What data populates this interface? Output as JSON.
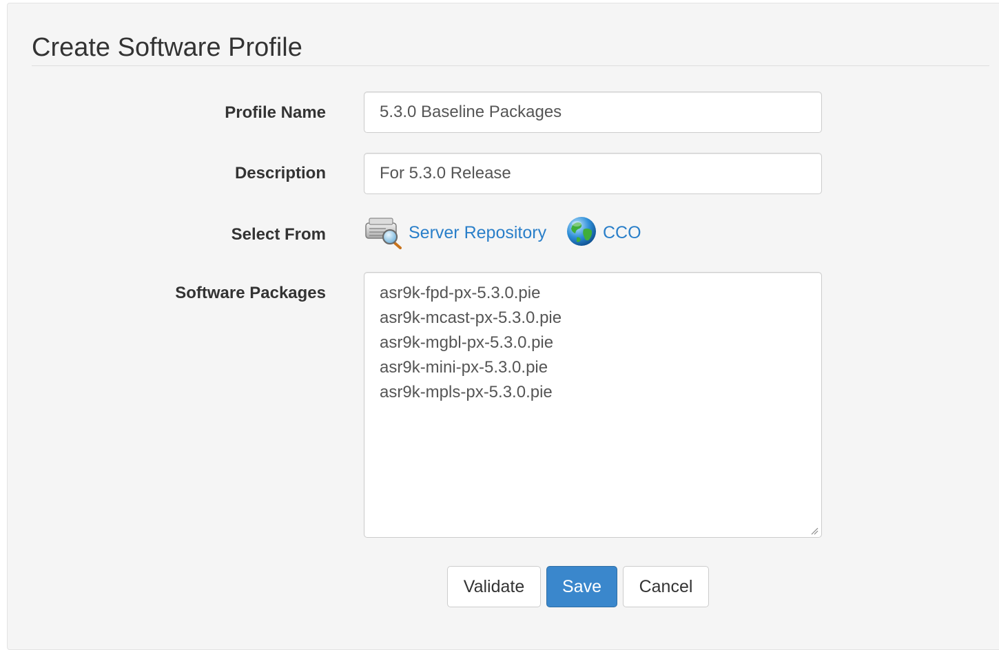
{
  "page": {
    "title": "Create Software Profile"
  },
  "form": {
    "profile_name": {
      "label": "Profile Name",
      "value": "5.3.0 Baseline Packages"
    },
    "description": {
      "label": "Description",
      "value": "For 5.3.0 Release"
    },
    "select_from": {
      "label": "Select From",
      "options": [
        {
          "label": "Server Repository",
          "icon": "server-repository-icon"
        },
        {
          "label": "CCO",
          "icon": "globe-icon"
        }
      ]
    },
    "software_packages": {
      "label": "Software Packages",
      "lines": [
        "asr9k-fpd-px-5.3.0.pie",
        "asr9k-mcast-px-5.3.0.pie",
        "asr9k-mgbl-px-5.3.0.pie",
        "asr9k-mini-px-5.3.0.pie",
        "asr9k-mpls-px-5.3.0.pie"
      ]
    }
  },
  "actions": {
    "validate_label": "Validate",
    "save_label": "Save",
    "cancel_label": "Cancel"
  },
  "colors": {
    "link": "#2a7fc9",
    "primary_button": "#3a87cc",
    "panel_background": "#f5f5f5"
  }
}
